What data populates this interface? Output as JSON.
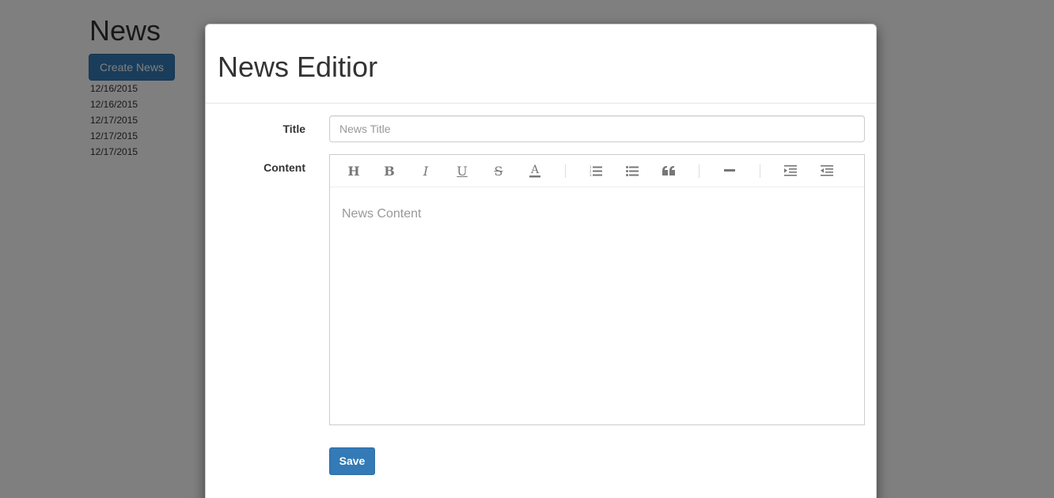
{
  "page": {
    "title": "News",
    "create_button": "Create News",
    "dates": [
      "12/16/2015",
      "12/16/2015",
      "12/17/2015",
      "12/17/2015",
      "12/17/2015"
    ]
  },
  "modal": {
    "title": "News Editior",
    "title_label": "Title",
    "title_placeholder": "News Title",
    "content_label": "Content",
    "content_placeholder": "News Content",
    "save_button": "Save"
  },
  "toolbar": {
    "icons": [
      "heading-icon",
      "bold-icon",
      "italic-icon",
      "underline-icon",
      "strikethrough-icon",
      "font-color-icon",
      "ordered-list-icon",
      "unordered-list-icon",
      "blockquote-icon",
      "horizontal-rule-icon",
      "indent-icon",
      "outdent-icon"
    ]
  },
  "colors": {
    "primary": "#337ab7",
    "backdrop": "#000000"
  }
}
